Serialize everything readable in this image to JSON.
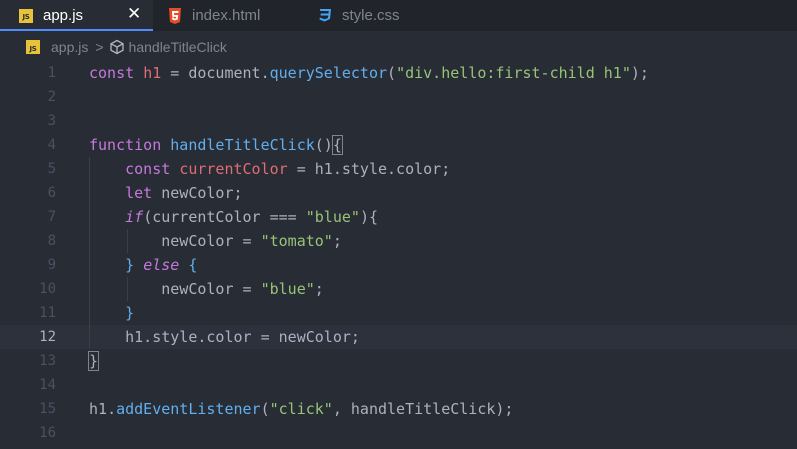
{
  "tabs": [
    {
      "label": "app.js",
      "badge": "JS",
      "close": "✕",
      "active": true
    },
    {
      "label": "index.html",
      "active": false
    },
    {
      "label": "style.css",
      "active": false
    }
  ],
  "breadcrumb": {
    "file": "app.js",
    "badge": "JS",
    "separator": ">",
    "symbol": "handleTitleClick"
  },
  "editor": {
    "current_line": 12,
    "line_numbers": [
      "1",
      "2",
      "3",
      "4",
      "5",
      "6",
      "7",
      "8",
      "9",
      "10",
      "11",
      "12",
      "13",
      "14",
      "15",
      "16"
    ],
    "lines": [
      [
        {
          "t": "const ",
          "c": "kw"
        },
        {
          "t": "h1",
          "c": "var"
        },
        {
          "t": " = ",
          "c": "plain"
        },
        {
          "t": "document",
          "c": "plain"
        },
        {
          "t": ".",
          "c": "plain"
        },
        {
          "t": "querySelector",
          "c": "fn"
        },
        {
          "t": "(",
          "c": "plain"
        },
        {
          "t": "\"div.hello:first-child h1\"",
          "c": "str"
        },
        {
          "t": ");",
          "c": "plain"
        }
      ],
      [],
      [],
      [
        {
          "t": "function ",
          "c": "kw"
        },
        {
          "t": "handleTitleClick",
          "c": "fn"
        },
        {
          "t": "()",
          "c": "plain"
        },
        {
          "t": "{",
          "c": "plain brk-hl"
        }
      ],
      [
        {
          "t": "    ",
          "c": "plain"
        },
        {
          "t": "const ",
          "c": "kw"
        },
        {
          "t": "currentColor",
          "c": "var"
        },
        {
          "t": " = ",
          "c": "plain"
        },
        {
          "t": "h1.style.color;",
          "c": "plain"
        }
      ],
      [
        {
          "t": "    ",
          "c": "plain"
        },
        {
          "t": "let ",
          "c": "kw"
        },
        {
          "t": "newColor;",
          "c": "plain"
        }
      ],
      [
        {
          "t": "    ",
          "c": "plain"
        },
        {
          "t": "if",
          "c": "kw ital"
        },
        {
          "t": "(currentColor === ",
          "c": "plain"
        },
        {
          "t": "\"blue\"",
          "c": "str"
        },
        {
          "t": "){",
          "c": "plain"
        }
      ],
      [
        {
          "t": "        ",
          "c": "plain"
        },
        {
          "t": "newColor = ",
          "c": "plain"
        },
        {
          "t": "\"tomato\"",
          "c": "str"
        },
        {
          "t": ";",
          "c": "plain"
        }
      ],
      [
        {
          "t": "    ",
          "c": "plain"
        },
        {
          "t": "} ",
          "c": "fn"
        },
        {
          "t": "else",
          "c": "kw ital"
        },
        {
          "t": " {",
          "c": "fn"
        }
      ],
      [
        {
          "t": "        ",
          "c": "plain"
        },
        {
          "t": "newColor = ",
          "c": "plain"
        },
        {
          "t": "\"blue\"",
          "c": "str"
        },
        {
          "t": ";",
          "c": "plain"
        }
      ],
      [
        {
          "t": "    ",
          "c": "plain"
        },
        {
          "t": "}",
          "c": "fn"
        }
      ],
      [
        {
          "t": "    ",
          "c": "plain"
        },
        {
          "t": "h1.style.color = newColor;",
          "c": "plain"
        }
      ],
      [
        {
          "t": "}",
          "c": "plain brk-hl"
        }
      ],
      [],
      [
        {
          "t": "h1",
          "c": "plain"
        },
        {
          "t": ".",
          "c": "plain"
        },
        {
          "t": "addEventListener",
          "c": "fn"
        },
        {
          "t": "(",
          "c": "plain"
        },
        {
          "t": "\"click\"",
          "c": "str"
        },
        {
          "t": ", handleTitleClick);",
          "c": "plain"
        }
      ],
      []
    ]
  },
  "colors": {
    "background": "#282c34",
    "tabbar": "#21252b",
    "keyword": "#c678dd",
    "variable": "#e06c75",
    "function": "#61afef",
    "string": "#98c379"
  }
}
